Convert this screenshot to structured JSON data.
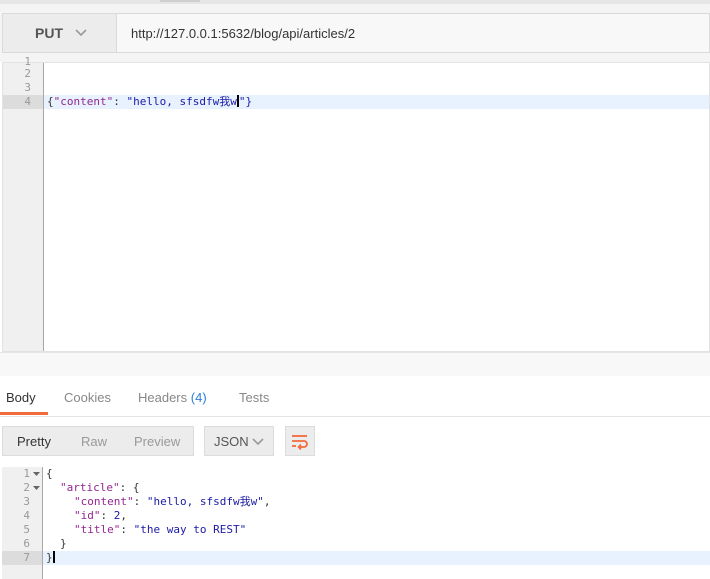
{
  "request": {
    "method": "PUT",
    "url": "http://127.0.0.1:5632/blog/api/articles/2"
  },
  "request_body": {
    "line_numbers": [
      "2",
      "3",
      "4"
    ],
    "line4_open": "{",
    "line4_key": "\"content\"",
    "line4_colon": ": ",
    "line4_value_a": "\"hello, sfsdfw我w",
    "line4_value_b": "\"}"
  },
  "response_tabs": [
    {
      "label": "Body",
      "active": true
    },
    {
      "label": "Cookies",
      "active": false
    },
    {
      "label": "Headers",
      "count": "(4)",
      "active": false
    },
    {
      "label": "Tests",
      "active": false
    }
  ],
  "view_modes": [
    "Pretty",
    "Raw",
    "Preview"
  ],
  "active_view": "Pretty",
  "format": "JSON",
  "response_body": {
    "line_numbers": [
      "1",
      "2",
      "3",
      "4",
      "5",
      "6",
      "7"
    ],
    "l1": "{",
    "l2_key": "\"article\"",
    "l2_rest": ": {",
    "l3_key": "\"content\"",
    "l3_val": "\"hello, sfsdfw我w\"",
    "l4_key": "\"id\"",
    "l4_val": "2",
    "l5_key": "\"title\"",
    "l5_val": "\"the way to REST\"",
    "l6": "}",
    "l7": "}"
  },
  "colors": {
    "accent": "#f26b3a",
    "count": "#2a7fd6",
    "json_key": "#92278f",
    "json_string": "#1a1aa6"
  },
  "icons": [
    "chevron-down-icon",
    "wrap-lines-icon",
    "fold-arrow-icon"
  ]
}
